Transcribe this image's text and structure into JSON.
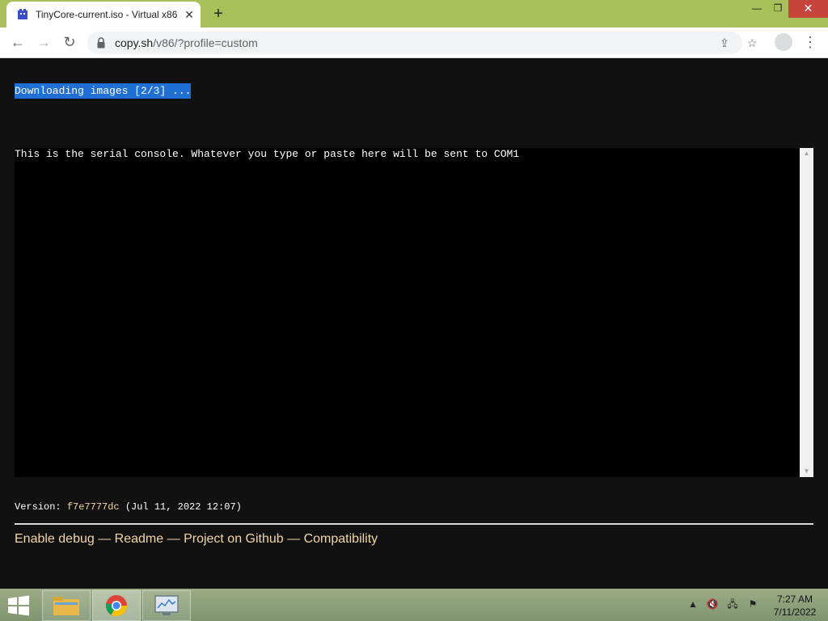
{
  "browser": {
    "tab_title": "TinyCore-current.iso - Virtual x86",
    "new_tab_label": "+",
    "url_host": "copy.sh",
    "url_path": "/v86/?profile=custom"
  },
  "page": {
    "status_text": "Downloading images [2/3] ...",
    "console_text": "This is the serial console. Whatever you type or paste here will be sent to COM1",
    "version_label": "Version:",
    "version_hash": "f7e7777dc",
    "version_date": "(Jul 11, 2022 12:07)",
    "links": [
      "Enable debug",
      "Readme",
      "Project on Github",
      "Compatibility"
    ],
    "link_separator": "—"
  },
  "taskbar": {
    "time": "7:27 AM",
    "date": "7/11/2022"
  },
  "colors": {
    "titlebar": "#a9c05a",
    "status_highlight": "#1f6fd4",
    "link": "#f3d6a7",
    "close_button": "#c7443a"
  },
  "icons": {
    "tab_favicon": "v86-icon",
    "tab_close": "close-icon",
    "back": "back-arrow-icon",
    "forward": "forward-arrow-icon",
    "reload": "reload-icon",
    "lock": "lock-icon",
    "share": "share-icon",
    "bookmark": "star-icon",
    "profile": "profile-icon",
    "menu": "kebab-menu-icon"
  }
}
